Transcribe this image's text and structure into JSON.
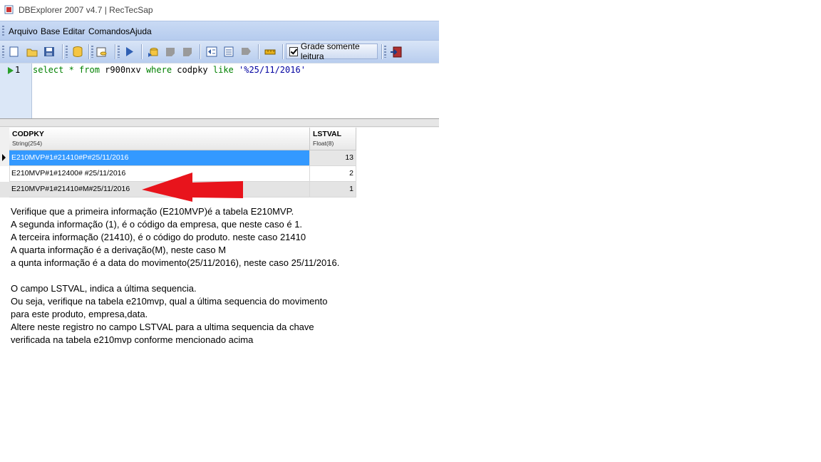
{
  "window": {
    "title": "DBExplorer 2007 v4.7 | RecTecSap"
  },
  "menu": [
    "Arquivo",
    "Base",
    "Editar",
    "Comandos",
    "Ajuda"
  ],
  "toolbar": {
    "readonly_label": "Grade somente leitura",
    "readonly_checked": true
  },
  "editor": {
    "line_number": "1",
    "tokens": {
      "t1": "select * from",
      "t2": " r900nxv ",
      "t3": "where",
      "t4": " codpky ",
      "t5": "like",
      "t6": " '%25/11/2016'"
    }
  },
  "grid": {
    "columns": [
      {
        "name": "CODPKY",
        "type": "String(254)"
      },
      {
        "name": "LSTVAL",
        "type": "Float(8)"
      }
    ],
    "rows": [
      {
        "codpky": "E210MVP#1#21410#P#25/11/2016",
        "lstval": "13"
      },
      {
        "codpky": "E210MVP#1#12400# #25/11/2016",
        "lstval": "2"
      },
      {
        "codpky": "E210MVP#1#21410#M#25/11/2016",
        "lstval": "1"
      }
    ]
  },
  "annotation": {
    "arrow_color": "#e8141c"
  },
  "instructions": [
    "Verifique que a primeira informação (E210MVP)é a tabela E210MVP.",
    "A segunda informação (1), é o código da empresa, que neste caso é 1.",
    "A terceira informação (21410), é o código do produto. neste caso 21410",
    "A quarta informação é a derivação(M), neste caso M",
    "a qunta informação é a data do movimento(25/11/2016), neste caso 25/11/2016.",
    "",
    "O campo LSTVAL, indica a última sequencia.",
    "Ou seja, verifique na tabela e210mvp, qual a última sequencia do movimento",
    "para este produto, empresa,data.",
    "Altere neste registro no campo LSTVAL para a ultima sequencia da chave",
    "verificada na tabela e210mvp conforme mencionado acima"
  ]
}
